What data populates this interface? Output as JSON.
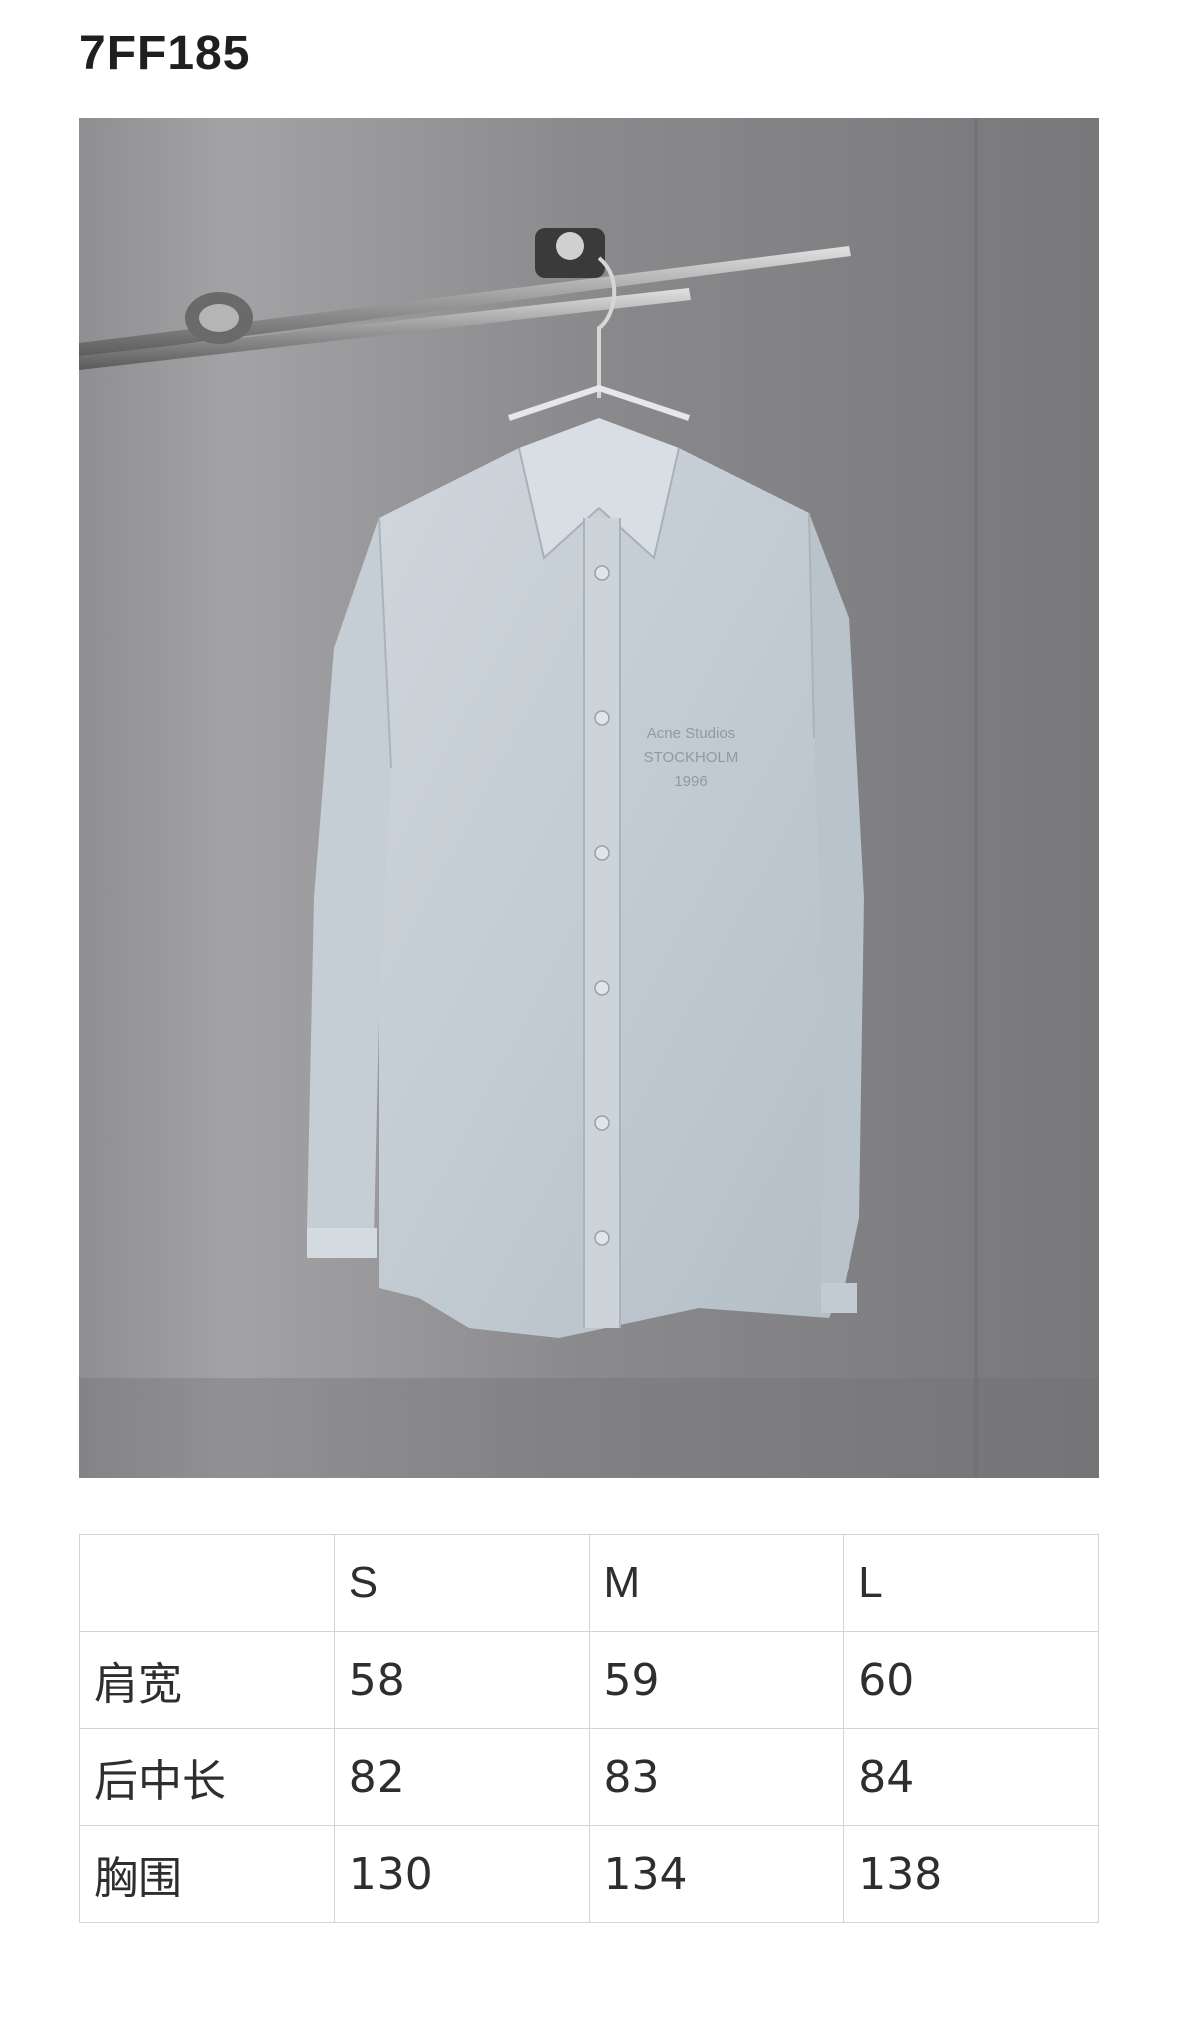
{
  "header": {
    "product_code": "7FF185"
  },
  "product_image": {
    "alt": "shirt-photo",
    "shirt_color": "#c3ccd3",
    "background_color": "#8e8e90",
    "print_lines": [
      "Acne Studios",
      "STOCKHOLM",
      "1996"
    ]
  },
  "size_table": {
    "columns": [
      "",
      "S",
      "M",
      "L"
    ],
    "rows": [
      {
        "label": "肩宽",
        "values": [
          "58",
          "59",
          "60"
        ]
      },
      {
        "label": "后中长",
        "values": [
          "82",
          "83",
          "84"
        ]
      },
      {
        "label": "胸围",
        "values": [
          "130",
          "134",
          "138"
        ]
      }
    ]
  }
}
